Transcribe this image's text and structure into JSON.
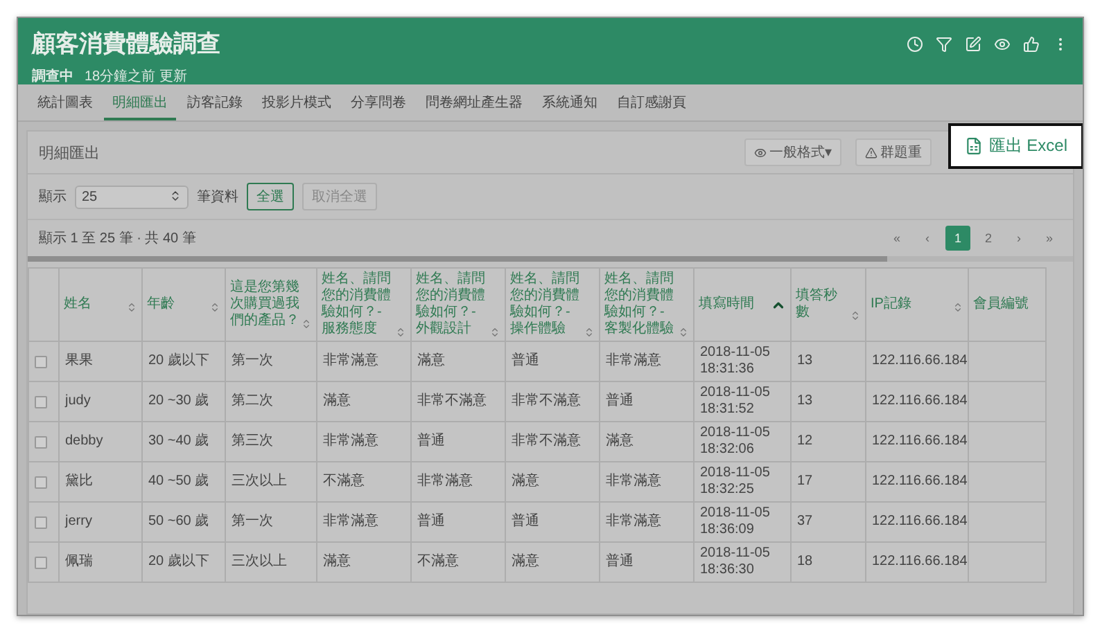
{
  "header": {
    "title": "顧客消費體驗調查",
    "status": "調查中",
    "updated": "18分鐘之前 更新"
  },
  "tabs": [
    {
      "label": "統計圖表",
      "selected": false
    },
    {
      "label": "明細匯出",
      "selected": true
    },
    {
      "label": "訪客記錄",
      "selected": false
    },
    {
      "label": "投影片模式",
      "selected": false
    },
    {
      "label": "分享問卷",
      "selected": false
    },
    {
      "label": "問卷網址產生器",
      "selected": false
    },
    {
      "label": "系統通知",
      "selected": false
    },
    {
      "label": "自訂感謝頁",
      "selected": false
    }
  ],
  "panel": {
    "title": "明細匯出",
    "format_button": "一般格式▾",
    "group_button": "群題重"
  },
  "callout": {
    "label": "匯出 Excel"
  },
  "controls": {
    "show_label": "顯示",
    "page_size": "25",
    "unit_label": "筆資料",
    "select_all": "全選",
    "deselect_all": "取消全選"
  },
  "summary": "顯示 1 至 25 筆 · 共 40 筆",
  "pagination": [
    {
      "label": "«",
      "selected": false
    },
    {
      "label": "‹",
      "selected": false
    },
    {
      "label": "1",
      "selected": true
    },
    {
      "label": "2",
      "selected": false
    },
    {
      "label": "›",
      "selected": false
    },
    {
      "label": "»",
      "selected": false
    }
  ],
  "table": {
    "columns": [
      {
        "label": "姓名",
        "sortable": true,
        "sorted": false
      },
      {
        "label": "年齡",
        "sortable": true,
        "sorted": false
      },
      {
        "label": "這是您第幾次購買過我們的產品？",
        "sortable": true,
        "sorted": false
      },
      {
        "label": "姓名、請問您的消費體驗如何？- 服務態度",
        "sortable": true,
        "sorted": false
      },
      {
        "label": "姓名、請問您的消費體驗如何？- 外觀設計",
        "sortable": true,
        "sorted": false
      },
      {
        "label": "姓名、請問您的消費體驗如何？- 操作體驗",
        "sortable": true,
        "sorted": false
      },
      {
        "label": "姓名、請問您的消費體驗如何？- 客製化體驗",
        "sortable": true,
        "sorted": false
      },
      {
        "label": "填寫時間",
        "sortable": true,
        "sorted": true
      },
      {
        "label": "填答秒數",
        "sortable": true,
        "sorted": false
      },
      {
        "label": "IP記錄",
        "sortable": true,
        "sorted": false
      },
      {
        "label": "會員編號"
      }
    ],
    "rows": [
      {
        "checked": false,
        "cells": [
          "果果",
          "20 歲以下",
          "第一次",
          "非常滿意",
          "滿意",
          "普通",
          "非常滿意",
          "2018-11-05 18:31:36",
          "13",
          "122.116.66.184",
          ""
        ]
      },
      {
        "checked": false,
        "cells": [
          "judy",
          "20 ~30 歲",
          "第二次",
          "滿意",
          "非常不滿意",
          "非常不滿意",
          "普通",
          "2018-11-05 18:31:52",
          "13",
          "122.116.66.184",
          ""
        ]
      },
      {
        "checked": false,
        "cells": [
          "debby",
          "30 ~40 歲",
          "第三次",
          "非常滿意",
          "普通",
          "非常不滿意",
          "滿意",
          "2018-11-05 18:32:06",
          "12",
          "122.116.66.184",
          ""
        ]
      },
      {
        "checked": false,
        "cells": [
          "黛比",
          "40 ~50 歲",
          "三次以上",
          "不滿意",
          "非常滿意",
          "滿意",
          "非常滿意",
          "2018-11-05 18:32:25",
          "17",
          "122.116.66.184",
          ""
        ]
      },
      {
        "checked": false,
        "cells": [
          "jerry",
          "50 ~60 歲",
          "第一次",
          "非常滿意",
          "普通",
          "普通",
          "非常滿意",
          "2018-11-05 18:36:09",
          "37",
          "122.116.66.184",
          ""
        ]
      },
      {
        "checked": false,
        "cells": [
          "佩瑞",
          "20 歲以下",
          "三次以上",
          "滿意",
          "不滿意",
          "滿意",
          "普通",
          "2018-11-05 18:36:30",
          "18",
          "122.116.66.184",
          ""
        ]
      }
    ]
  }
}
